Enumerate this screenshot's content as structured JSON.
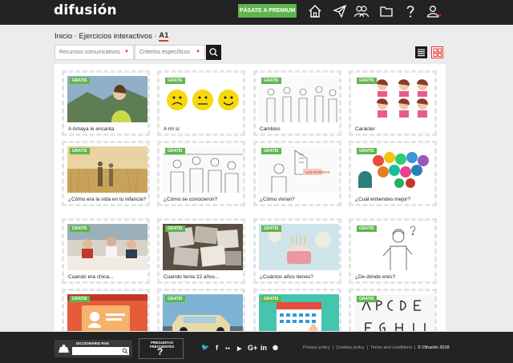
{
  "header": {
    "logo": "difusión",
    "premium_label": "PÁSATE A PREMIUM",
    "nav_icons": [
      "home-icon",
      "send-icon",
      "users-icon",
      "folder-icon",
      "help-icon",
      "user-icon"
    ]
  },
  "breadcrumb": {
    "home": "Inicio",
    "section": "Ejercicios interactivos",
    "level": "A1"
  },
  "filters": {
    "recursos": "Recursos comunicativos",
    "criterios": "Criterios específicos"
  },
  "badge": "GRATIS",
  "cards": [
    {
      "title": "A Amaya le encanta"
    },
    {
      "title": "A mí sí"
    },
    {
      "title": "Cambios"
    },
    {
      "title": "Carácter"
    },
    {
      "title": "¿Cómo era la vida en tu infancia?"
    },
    {
      "title": "¿Cómo se conocieron?"
    },
    {
      "title": "¿Cómo vivían?"
    },
    {
      "title": "¿Cuál entiendes mejor?"
    },
    {
      "title": "Cuando era chica..."
    },
    {
      "title": "Cuando tenía 22 años..."
    },
    {
      "title": "¿Cuántos años tienes?"
    },
    {
      "title": "¿De dónde eres?"
    },
    {
      "title": ""
    },
    {
      "title": ""
    },
    {
      "title": ""
    },
    {
      "title": ""
    }
  ],
  "footer": {
    "dictionary_label": "DICCIONARIO RAE",
    "faq_label": "PREGUNTAS FRECUENTES",
    "faq_symbol": "?",
    "links": [
      "Privacy policy",
      "Cookies policy",
      "Terms and conditions"
    ],
    "copyright": "© Difusión 2018",
    "social": {
      "twitter": "🐦",
      "facebook": "f",
      "flickr": "●●",
      "youtube": "▶",
      "googleplus": "G+",
      "linkedin": "in",
      "rss": "◉"
    }
  }
}
